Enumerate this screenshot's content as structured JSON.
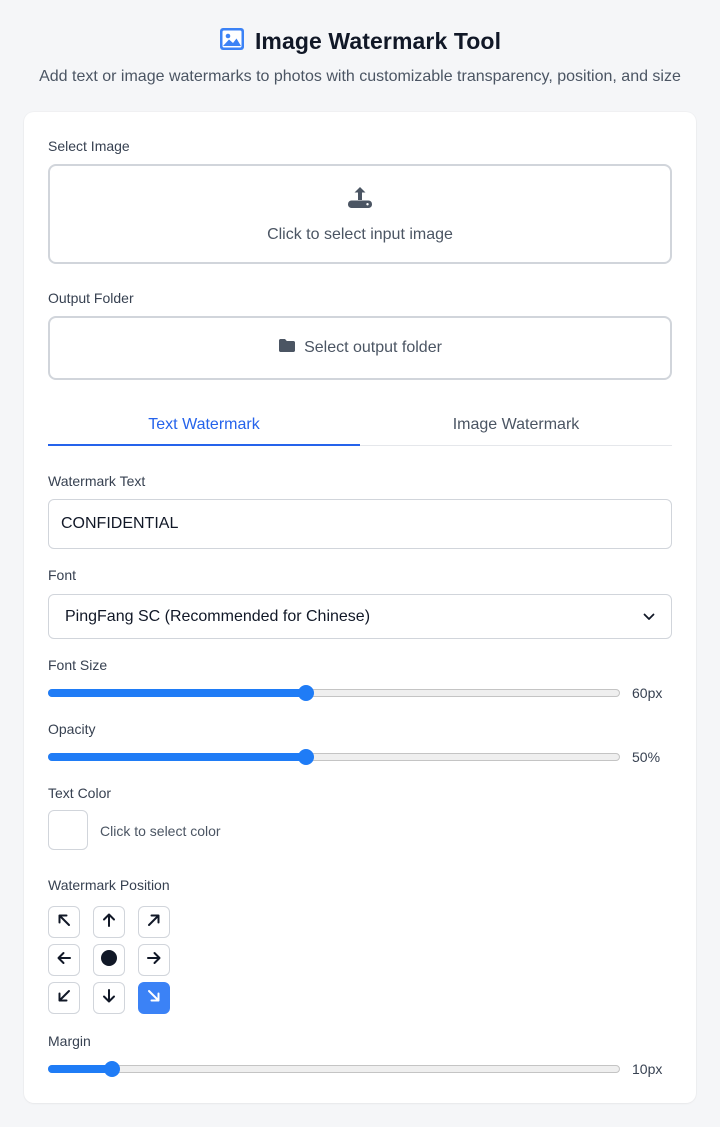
{
  "header": {
    "title": "Image Watermark Tool",
    "subtitle": "Add text or image watermarks to photos with customizable transparency, position, and size",
    "icon": "image-icon",
    "icon_color": "#3b82f6"
  },
  "select_image": {
    "label": "Select Image",
    "prompt": "Click to select input image",
    "icon": "upload-icon"
  },
  "output_folder": {
    "label": "Output Folder",
    "button": "Select output folder",
    "icon": "folder-icon"
  },
  "tabs": [
    {
      "label": "Text Watermark",
      "active": true
    },
    {
      "label": "Image Watermark",
      "active": false
    }
  ],
  "watermark_text": {
    "label": "Watermark Text",
    "value": "CONFIDENTIAL"
  },
  "font": {
    "label": "Font",
    "selected": "PingFang SC (Recommended for Chinese)"
  },
  "font_size": {
    "label": "Font Size",
    "display": "60px",
    "fraction": 0.45
  },
  "opacity": {
    "label": "Opacity",
    "display": "50%",
    "fraction": 0.45
  },
  "text_color": {
    "label": "Text Color",
    "prompt": "Click to select color",
    "value": "#ffffff"
  },
  "position": {
    "label": "Watermark Position",
    "options": [
      {
        "icon": "arrow-up-left-icon",
        "active": false
      },
      {
        "icon": "arrow-up-icon",
        "active": false
      },
      {
        "icon": "arrow-up-right-icon",
        "active": false
      },
      {
        "icon": "arrow-left-icon",
        "active": false
      },
      {
        "icon": "center-dot-icon",
        "active": false
      },
      {
        "icon": "arrow-right-icon",
        "active": false
      },
      {
        "icon": "arrow-down-left-icon",
        "active": false
      },
      {
        "icon": "arrow-down-icon",
        "active": false
      },
      {
        "icon": "arrow-down-right-icon",
        "active": true
      }
    ]
  },
  "margin": {
    "label": "Margin",
    "display": "10px",
    "fraction": 0.11
  },
  "colors": {
    "accent": "#2563eb",
    "slider": "#1f7cf6",
    "active_position": "#3b82f6"
  }
}
